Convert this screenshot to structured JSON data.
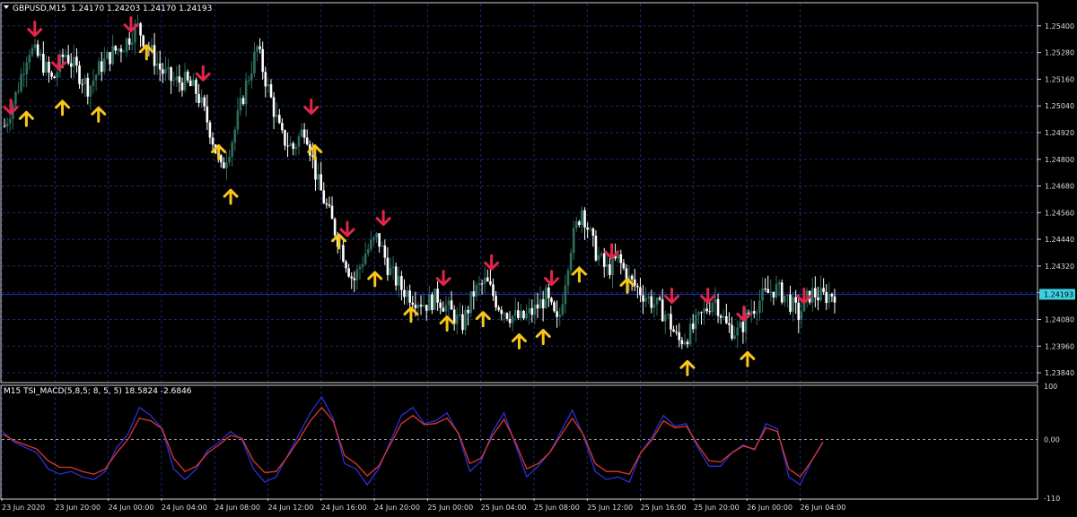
{
  "main_panel": {
    "title": "GBPUSD,M15",
    "ohlc": "1.24170 1.24203 1.24170 1.24193",
    "price_labels": [
      "1.25400",
      "1.25280",
      "1.25160",
      "1.25040",
      "1.24920",
      "1.24800",
      "1.24680",
      "1.24560",
      "1.24440",
      "1.24320",
      "1.24200",
      "1.24080",
      "1.23960",
      "1.23840"
    ],
    "current_price": "1.24193"
  },
  "indicator_panel": {
    "title": "M15 TSI_MACD(5,8,5; 8, 5, 5) 18.5824 -2.6846",
    "levels": [
      "100",
      "0.00",
      "-110"
    ]
  },
  "time_labels": [
    "23 Jun 2020",
    "23 Jun 20:00",
    "24 Jun 00:00",
    "24 Jun 04:00",
    "24 Jun 08:00",
    "24 Jun 12:00",
    "24 Jun 16:00",
    "24 Jun 20:00",
    "25 Jun 00:00",
    "25 Jun 04:00",
    "25 Jun 08:00",
    "25 Jun 12:00",
    "25 Jun 16:00",
    "25 Jun 20:00",
    "26 Jun 00:00",
    "26 Jun 04:00"
  ],
  "colors": {
    "background": "#000000",
    "grid": "#1c2a78",
    "frame": "#cfcfcf",
    "bull_candle": "#2e6e5e",
    "bear_candle": "#ffffff",
    "buy_arrow": "#f7c51b",
    "sell_arrow": "#e0264a",
    "bid_line": "#1f2fa8",
    "price_tag": "#3fd0e0",
    "tsi_line": "#2a30d8",
    "signal_line": "#e0382c"
  },
  "chart_data": [
    {
      "type": "candlestick",
      "title": "GBPUSD,M15",
      "ylim": [
        1.238,
        1.255
      ],
      "price_path": [
        [
          0,
          1.2495
        ],
        [
          1,
          1.251
        ],
        [
          2,
          1.253
        ],
        [
          3,
          1.2525
        ],
        [
          4,
          1.2515
        ],
        [
          5,
          1.2528
        ],
        [
          6,
          1.252
        ],
        [
          7,
          1.2512
        ],
        [
          8,
          1.2522
        ],
        [
          9,
          1.2528
        ],
        [
          10,
          1.2532
        ],
        [
          11,
          1.254
        ],
        [
          12,
          1.253
        ],
        [
          13,
          1.252
        ],
        [
          14,
          1.2515
        ],
        [
          15,
          1.2515
        ],
        [
          16,
          1.251
        ],
        [
          17,
          1.2495
        ],
        [
          18,
          1.2475
        ],
        [
          19,
          1.249
        ],
        [
          20,
          1.2512
        ],
        [
          21,
          1.253
        ],
        [
          22,
          1.251
        ],
        [
          23,
          1.249
        ],
        [
          24,
          1.2485
        ],
        [
          25,
          1.2495
        ],
        [
          26,
          1.247
        ],
        [
          27,
          1.2455
        ],
        [
          28,
          1.244
        ],
        [
          29,
          1.2425
        ],
        [
          30,
          1.2438
        ],
        [
          31,
          1.2445
        ],
        [
          32,
          1.243
        ],
        [
          33,
          1.2422
        ],
        [
          34,
          1.2418
        ],
        [
          35,
          1.2415
        ],
        [
          36,
          1.2418
        ],
        [
          37,
          1.2412
        ],
        [
          38,
          1.2405
        ],
        [
          39,
          1.242
        ],
        [
          40,
          1.2425
        ],
        [
          41,
          1.2415
        ],
        [
          42,
          1.241
        ],
        [
          43,
          1.2408
        ],
        [
          44,
          1.2412
        ],
        [
          45,
          1.2418
        ],
        [
          46,
          1.2405
        ],
        [
          47,
          1.244
        ],
        [
          48,
          1.2458
        ],
        [
          49,
          1.244
        ],
        [
          50,
          1.243
        ],
        [
          51,
          1.2435
        ],
        [
          52,
          1.2425
        ],
        [
          53,
          1.242
        ],
        [
          54,
          1.2415
        ],
        [
          55,
          1.241
        ],
        [
          56,
          1.2398
        ],
        [
          57,
          1.2402
        ],
        [
          58,
          1.241
        ],
        [
          59,
          1.2418
        ],
        [
          60,
          1.2405
        ],
        [
          61,
          1.2402
        ],
        [
          62,
          1.2412
        ],
        [
          63,
          1.2418
        ],
        [
          64,
          1.2422
        ],
        [
          65,
          1.2418
        ],
        [
          66,
          1.241
        ],
        [
          67,
          1.242
        ],
        [
          68,
          1.2418
        ],
        [
          69,
          1.242
        ]
      ],
      "buy_signals": [
        1,
        4,
        7,
        11,
        17,
        18,
        25,
        27,
        30,
        33,
        36,
        39,
        42,
        44,
        47,
        51,
        56,
        61
      ],
      "sell_signals": [
        0,
        2,
        4,
        10,
        16,
        25,
        28,
        31,
        36,
        40,
        45,
        50,
        55,
        58,
        61,
        66
      ],
      "current_price": 1.24193
    },
    {
      "type": "line",
      "title": "M15 TSI_MACD(5,8,5; 8, 5, 5)",
      "ylim": [
        -110,
        100
      ],
      "series": [
        {
          "values": [
            15,
            -5,
            -15,
            -25,
            -55,
            -65,
            -60,
            -70,
            -75,
            -60,
            -15,
            10,
            60,
            45,
            20,
            -55,
            -75,
            -55,
            -20,
            -5,
            15,
            0,
            -55,
            -80,
            -70,
            -30,
            10,
            50,
            80,
            40,
            -45,
            -55,
            -85,
            -55,
            -5,
            45,
            60,
            30,
            35,
            50,
            10,
            -60,
            -40,
            15,
            50,
            -10,
            -70,
            -50,
            -25,
            15,
            55,
            5,
            -60,
            -75,
            -70,
            -80,
            -25,
            5,
            45,
            25,
            30,
            -15,
            -50,
            -50,
            -25,
            -10,
            -20,
            30,
            20,
            -70,
            -85,
            -40,
            -5
          ]
        },
        {
          "values": [
            10,
            -2,
            -10,
            -18,
            -40,
            -52,
            -52,
            -60,
            -65,
            -55,
            -25,
            0,
            40,
            35,
            20,
            -35,
            -60,
            -50,
            -25,
            -10,
            8,
            2,
            -40,
            -62,
            -60,
            -32,
            0,
            35,
            60,
            35,
            -30,
            -45,
            -68,
            -50,
            -10,
            30,
            45,
            28,
            30,
            40,
            12,
            -45,
            -35,
            8,
            38,
            -5,
            -55,
            -45,
            -25,
            8,
            40,
            8,
            -45,
            -60,
            -60,
            -65,
            -25,
            0,
            35,
            22,
            25,
            -10,
            -40,
            -42,
            -25,
            -12,
            -18,
            22,
            15,
            -55,
            -70,
            -40,
            -5
          ]
        }
      ],
      "levels": [
        100,
        0,
        -110
      ],
      "values": [
        18.5824,
        -2.6846
      ]
    }
  ]
}
